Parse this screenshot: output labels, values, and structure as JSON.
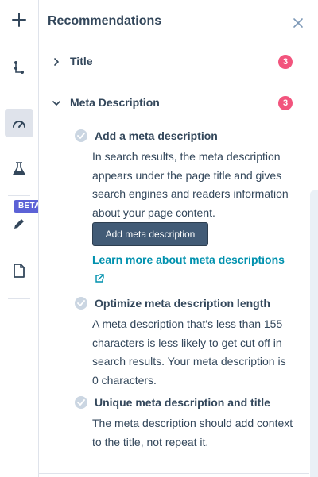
{
  "rail": {
    "beta_badge": "BETA",
    "icons": [
      "plus-icon",
      "tree-icon",
      "gauge-icon",
      "flask-icon",
      "pencil-icon",
      "document-icon"
    ]
  },
  "panel": {
    "title": "Recommendations",
    "close_icon": "close-icon"
  },
  "sections": [
    {
      "label": "Title",
      "count": "3",
      "expanded": false
    },
    {
      "label": "Meta Description",
      "count": "3",
      "expanded": true
    }
  ],
  "recommendations": [
    {
      "title": "Add a meta description",
      "body": "In search results, the meta description appears under the page title and gives search engines and readers information about your page content.",
      "button_label": "Add meta description",
      "link_label": "Learn more about meta descriptions"
    },
    {
      "title": "Optimize meta description length",
      "body": "A meta description that's less than 155 characters is less likely to get cut off in search results. Your meta description is 0 characters."
    },
    {
      "title": "Unique meta description and title",
      "body": "The meta description should add context to the title, not repeat it."
    }
  ],
  "colors": {
    "badge": "#f2547d",
    "link": "#0091ae",
    "button": "#425b76",
    "beta": "#5c62d6"
  }
}
